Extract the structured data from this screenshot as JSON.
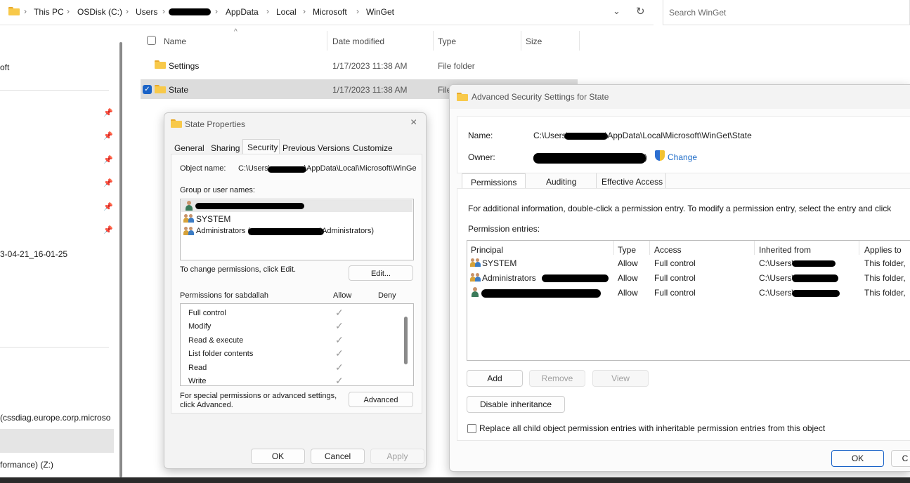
{
  "address": {
    "crumbs": [
      "This PC",
      "OSDisk (C:)",
      "Users",
      "AppData",
      "Local",
      "Microsoft",
      "WinGet"
    ],
    "search_placeholder": "Search WinGet"
  },
  "nav": {
    "partial_items": [
      "oft",
      "3-04-21_16-01-25",
      "(cssdiag.europe.corp.microso",
      "formance) (Z:)"
    ]
  },
  "file_list": {
    "columns": [
      "Name",
      "Date modified",
      "Type",
      "Size"
    ],
    "rows": [
      {
        "name": "Settings",
        "date": "1/17/2023 11:38 AM",
        "type": "File folder"
      },
      {
        "name": "State",
        "date": "1/17/2023 11:38 AM",
        "type": "File"
      }
    ]
  },
  "props": {
    "title": "State Properties",
    "tabs": [
      "General",
      "Sharing",
      "Security",
      "Previous Versions",
      "Customize"
    ],
    "object_name_label": "Object name:",
    "object_name_value": "C:\\Users\\",
    "object_name_value2": "\\AppData\\Local\\Microsoft\\WinGe",
    "group_label": "Group or user names:",
    "users": [
      "SYSTEM",
      "Administrators (",
      "\\Administrators)"
    ],
    "change_text": "To change permissions, click Edit.",
    "edit_btn": "Edit...",
    "perm_label": "Permissions for sabdallah",
    "allow_label": "Allow",
    "deny_label": "Deny",
    "permissions": [
      "Full control",
      "Modify",
      "Read & execute",
      "List folder contents",
      "Read",
      "Write"
    ],
    "special_text": "For special permissions or advanced settings, click Advanced.",
    "advanced_btn": "Advanced",
    "ok": "OK",
    "cancel": "Cancel",
    "apply": "Apply"
  },
  "adv": {
    "title": "Advanced Security Settings for State",
    "name_label": "Name:",
    "name_value1": "C:\\Users\\",
    "name_value2": "\\AppData\\Local\\Microsoft\\WinGet\\State",
    "owner_label": "Owner:",
    "owner_paren": ")",
    "change_link": "Change",
    "tabs": [
      "Permissions",
      "Auditing",
      "Effective Access"
    ],
    "info_text": "For additional information, double-click a permission entry. To modify a permission entry, select the entry and click",
    "entries_label": "Permission entries:",
    "columns": [
      "Principal",
      "Type",
      "Access",
      "Inherited from",
      "Applies to"
    ],
    "rows": [
      {
        "principal": "SYSTEM",
        "type": "Allow",
        "access": "Full control",
        "inherited": "C:\\Users\\",
        "applies": "This folder,"
      },
      {
        "principal": "Administrators",
        "type": "Allow",
        "access": "Full control",
        "inherited": "C:\\Users\\",
        "applies": "This folder,"
      },
      {
        "principal": "",
        "type": "Allow",
        "access": "Full control",
        "inherited": "C:\\Users\\",
        "applies": "This folder,"
      }
    ],
    "add_btn": "Add",
    "remove_btn": "Remove",
    "view_btn": "View",
    "disable_btn": "Disable inheritance",
    "replace_text": "Replace all child object permission entries with inheritable permission entries from this object",
    "ok": "OK"
  }
}
